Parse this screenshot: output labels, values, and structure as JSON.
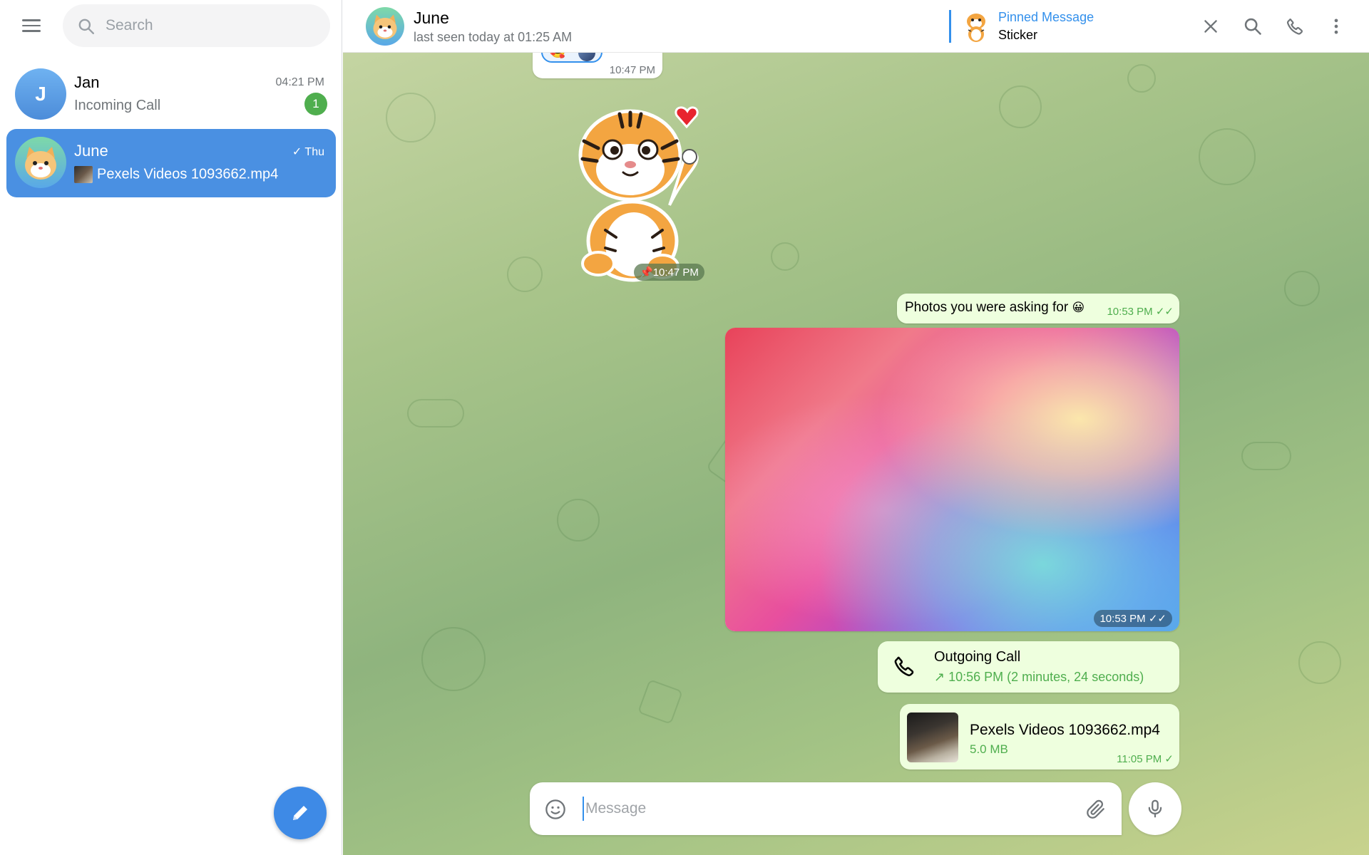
{
  "sidebar": {
    "search_placeholder": "Search",
    "chats": [
      {
        "name": "Jan",
        "initial": "J",
        "time": "04:21 PM",
        "preview": "Incoming Call",
        "unread": "1"
      },
      {
        "name": "June",
        "time": "Thu",
        "preview": "Pexels Videos 1093662.mp4",
        "active": true
      }
    ]
  },
  "header": {
    "name": "June",
    "status": "last seen today at 01:25 AM",
    "pinned_title": "Pinned Message",
    "pinned_text": "Sticker"
  },
  "messages": {
    "top_partial_time": "10:47 PM",
    "sticker_time": "10:47 PM",
    "text_msg": "Photos you were asking for",
    "text_msg_emoji": "😀",
    "text_time": "10:53 PM",
    "photo_time": "10:53 PM",
    "call_title": "Outgoing Call",
    "call_detail": "10:56 PM (2 minutes, 24 seconds)",
    "file_name": "Pexels Videos 1093662.mp4",
    "file_size": "5.0 MB",
    "file_time": "11:05 PM"
  },
  "composer": {
    "placeholder": "Message"
  },
  "colors": {
    "accent": "#3390ec",
    "active_chat": "#4a90e2",
    "outgoing_bubble": "#eeffde",
    "badge": "#4fae4e"
  }
}
